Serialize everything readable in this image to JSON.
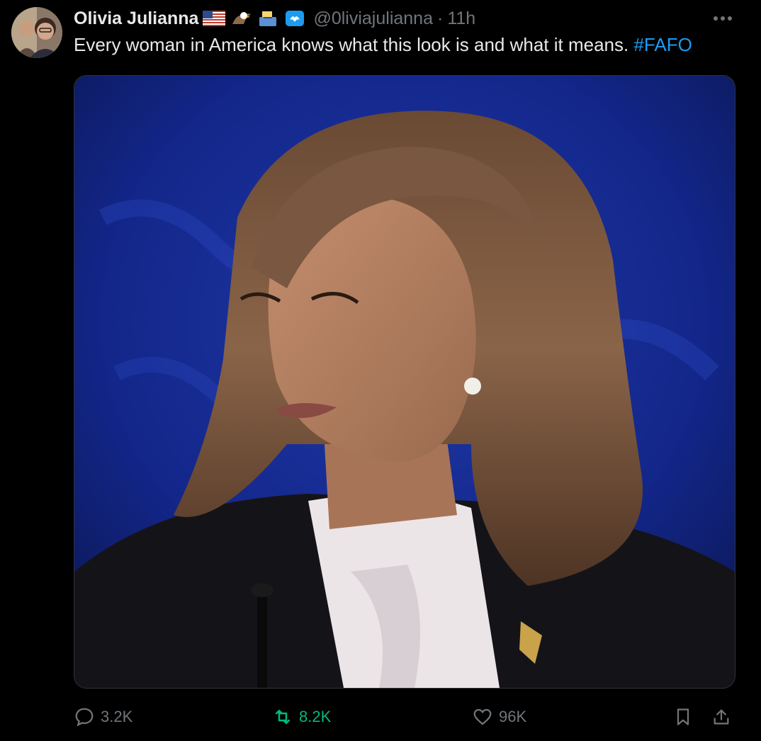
{
  "author": {
    "name": "Olivia Julianna",
    "handle": "@0liviajulianna",
    "time": "11h"
  },
  "tweet": {
    "text": "Every woman in America knows what this look is and what it means.",
    "hashtag": "#FAFO"
  },
  "actions": {
    "replies": "3.2K",
    "retweets": "8.2K",
    "likes": "96K"
  },
  "colors": {
    "accent": "#1d9bf0",
    "retweet": "#00ba7c",
    "muted": "#71767b"
  },
  "icons": {
    "more": "more-icon",
    "reply": "reply-icon",
    "retweet": "retweet-icon",
    "like": "heart-icon",
    "bookmark": "bookmark-icon",
    "share": "share-icon"
  }
}
